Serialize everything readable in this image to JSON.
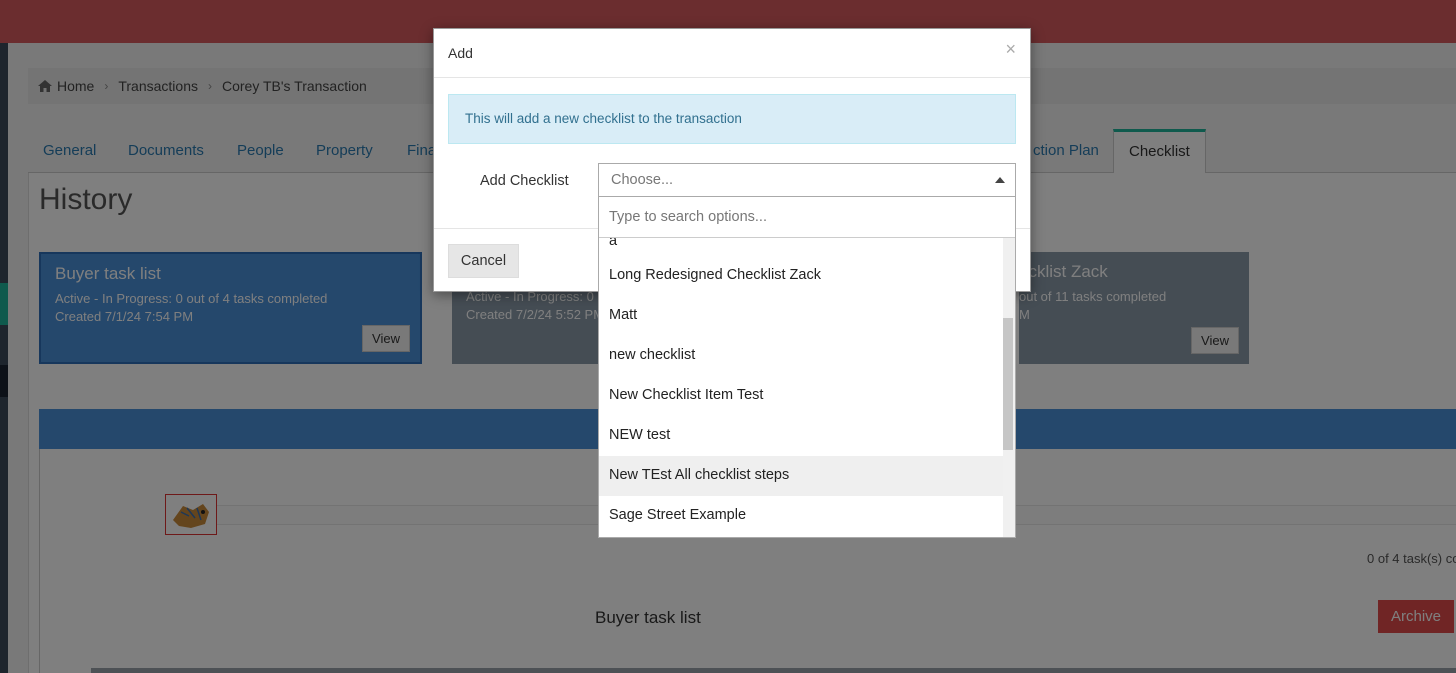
{
  "breadcrumb": [
    "Home",
    "Transactions",
    "Corey TB's Transaction"
  ],
  "tabs": {
    "general": "General",
    "documents": "Documents",
    "people": "People",
    "property": "Property",
    "finance_partial": "Fina",
    "action_plan_partial": "ction Plan",
    "checklist": "Checklist"
  },
  "history": {
    "title": "History",
    "cards": [
      {
        "title": "Buyer task list",
        "status": "Active - In Progress: 0 out of 4 tasks completed",
        "created": "Created 7/1/24 7:54 PM",
        "view": "View"
      },
      {
        "status_partial": "Active - In Progress: 0",
        "created_partial": "Created 7/2/24 5:52 PM"
      },
      {
        "title_partial": "ecklist Zack",
        "status_partial": "out of 11 tasks completed",
        "created_partial": "M",
        "view": "View"
      }
    ],
    "task_count": "0 of 4 task(s) co",
    "list_name": "Buyer task list",
    "archive": "Archive"
  },
  "modal": {
    "title": "Add",
    "close": "×",
    "alert": "This will add a new checklist to the transaction",
    "field_label": "Add Checklist",
    "select_placeholder": "Choose...",
    "search_placeholder": "Type to search options...",
    "cancel": "Cancel",
    "options": [
      "a",
      "Long Redesigned Checklist Zack",
      "Matt",
      "new checklist",
      "New Checklist Item Test",
      "NEW test",
      "New TEst All checklist steps",
      "Sage Street Example"
    ],
    "highlighted_option": "New TEst All checklist steps"
  },
  "colors": {
    "topbar": "#d75a5f",
    "accent": "#1fb49a",
    "card_active": "#4a90d9",
    "archive": "#e04b4b",
    "alert_bg": "#d9edf7"
  }
}
